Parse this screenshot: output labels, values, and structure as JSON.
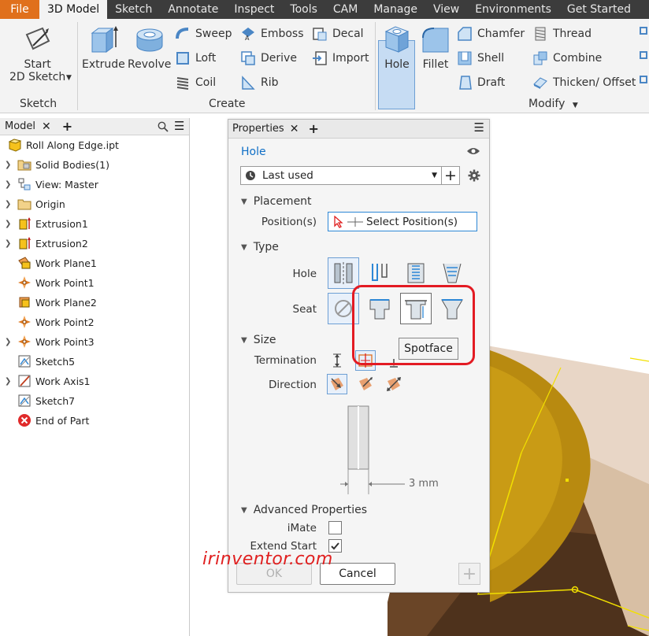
{
  "menu": {
    "file": "File",
    "tabs": [
      "3D Model",
      "Sketch",
      "Annotate",
      "Inspect",
      "Tools",
      "CAM",
      "Manage",
      "View",
      "Environments",
      "Get Started"
    ]
  },
  "ribbon": {
    "sketch_group": {
      "label": "Sketch",
      "start_line1": "Start",
      "start_line2": "2D Sketch"
    },
    "create_group": {
      "label": "Create",
      "extrude": "Extrude",
      "revolve": "Revolve",
      "sweep": "Sweep",
      "loft": "Loft",
      "coil": "Coil",
      "emboss": "Emboss",
      "derive": "Derive",
      "rib": "Rib",
      "decal": "Decal",
      "import": "Import"
    },
    "modify_group": {
      "label": "Modify",
      "hole": "Hole",
      "fillet": "Fillet",
      "chamfer": "Chamfer",
      "shell": "Shell",
      "draft": "Draft",
      "thread": "Thread",
      "combine": "Combine",
      "thicken": "Thicken/ Offset"
    }
  },
  "browser": {
    "tab": "Model",
    "items": [
      {
        "label": "Roll Along Edge.ipt",
        "expand": false,
        "indent": 0
      },
      {
        "label": "Solid Bodies(1)",
        "expand": true,
        "indent": 1
      },
      {
        "label": "View: Master",
        "expand": true,
        "indent": 1
      },
      {
        "label": "Origin",
        "expand": true,
        "indent": 1
      },
      {
        "label": "Extrusion1",
        "expand": true,
        "indent": 1
      },
      {
        "label": "Extrusion2",
        "expand": true,
        "indent": 1
      },
      {
        "label": "Work Plane1",
        "expand": false,
        "indent": 1
      },
      {
        "label": "Work Point1",
        "expand": false,
        "indent": 1
      },
      {
        "label": "Work Plane2",
        "expand": false,
        "indent": 1
      },
      {
        "label": "Work Point2",
        "expand": false,
        "indent": 1
      },
      {
        "label": "Work Point3",
        "expand": true,
        "indent": 1
      },
      {
        "label": "Sketch5",
        "expand": false,
        "indent": 1
      },
      {
        "label": "Work Axis1",
        "expand": true,
        "indent": 1
      },
      {
        "label": "Sketch7",
        "expand": false,
        "indent": 1
      },
      {
        "label": "End of Part",
        "expand": false,
        "indent": 1
      }
    ]
  },
  "properties": {
    "tab": "Properties",
    "feature": "Hole",
    "preset": "Last used",
    "placement": {
      "title": "Placement",
      "position_label": "Position(s)",
      "select_position": "Select Position(s)"
    },
    "type": {
      "title": "Type",
      "hole_label": "Hole",
      "seat_label": "Seat"
    },
    "size": {
      "title": "Size",
      "termination_label": "Termination",
      "direction_label": "Direction",
      "dimension": "3 mm"
    },
    "advanced": {
      "title": "Advanced Properties",
      "imate_label": "iMate",
      "imate_checked": false,
      "extend_start_label": "Extend Start",
      "extend_start_checked": true
    },
    "ok": "OK",
    "cancel": "Cancel"
  },
  "tooltip": "Spotface",
  "watermark": "irinventor.com",
  "colors": {
    "file_tab": "#e0701c",
    "accent": "#0f6fc6",
    "highlight_box": "#e31b23",
    "selected_bg": "#c6dcf3"
  }
}
